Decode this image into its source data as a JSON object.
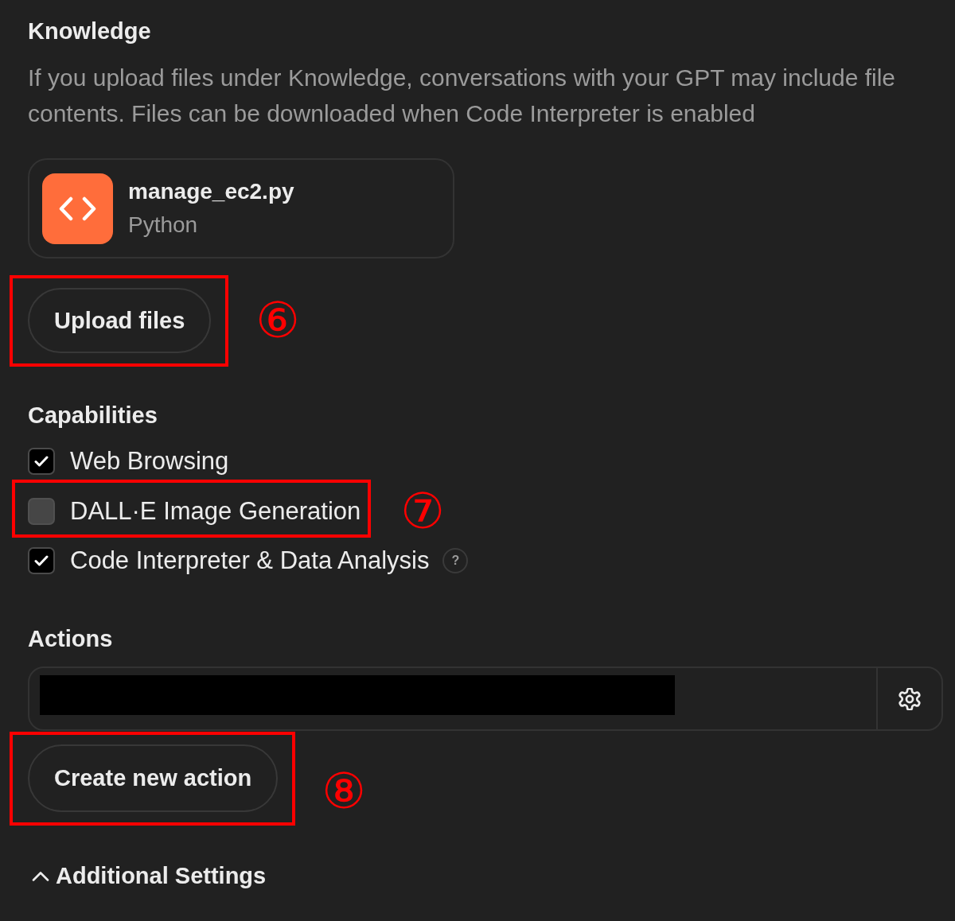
{
  "knowledge": {
    "title": "Knowledge",
    "description": "If you upload files under Knowledge, conversations with your GPT may include file contents. Files can be downloaded when Code Interpreter is enabled",
    "files": [
      {
        "name": "manage_ec2.py",
        "type": "Python"
      }
    ],
    "upload_button": {
      "label": "Upload files",
      "callout": "⑥"
    }
  },
  "capabilities": {
    "title": "Capabilities",
    "items": [
      {
        "label": "Web Browsing",
        "checked": true
      },
      {
        "label": "DALL·E Image Generation",
        "checked": false,
        "callout": "⑦"
      },
      {
        "label": "Code Interpreter & Data Analysis",
        "checked": true,
        "help": "?"
      }
    ]
  },
  "actions": {
    "title": "Actions",
    "items": [
      {
        "redacted": true
      }
    ],
    "create_button": {
      "label": "Create new action",
      "callout": "⑧"
    }
  },
  "additional_settings": {
    "label": "Additional Settings"
  }
}
